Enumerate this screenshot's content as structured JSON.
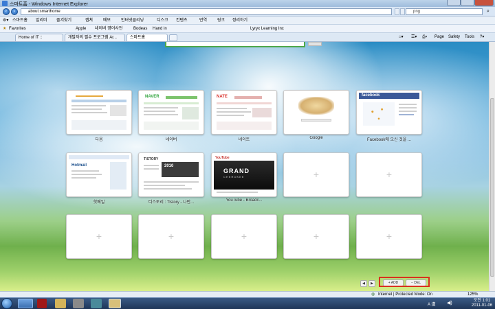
{
  "window": {
    "title": "스마트홈 - Windows Internet Explorer"
  },
  "address": {
    "url": "about:smarthome",
    "search_value": "png"
  },
  "toolbar": {
    "items": [
      "스마트홈",
      "알리미",
      "즐겨찾기",
      "캡쳐",
      "메모",
      "인터넷클리닝",
      "디스크",
      "컨텐츠",
      "번역",
      "링크",
      "정리하기"
    ]
  },
  "favorites": {
    "label": "Favorites",
    "items": [
      "Apple",
      "네이버 영어사전",
      "Bodeas",
      "Hand in"
    ],
    "extra": "Lyryx Learning Inc"
  },
  "tabs": [
    {
      "label": "Home of IT ::"
    },
    {
      "label": "개발자의 필수 프로그램 Ar..."
    },
    {
      "label": "스마트홈"
    }
  ],
  "commands": {
    "page": "Page",
    "safety": "Safety",
    "tools": "Tools"
  },
  "tiles": [
    {
      "label": "다음",
      "kind": "site"
    },
    {
      "label": "네이버",
      "kind": "site"
    },
    {
      "label": "네이트",
      "kind": "site"
    },
    {
      "label": "Google",
      "kind": "site"
    },
    {
      "label": "Facebook에 오신 것을 ...",
      "kind": "site"
    },
    {
      "label": "핫메일",
      "kind": "site"
    },
    {
      "label": "티스토리 : Tistory - 나만...",
      "kind": "site"
    },
    {
      "label": "YouTube - Broadc...",
      "kind": "site"
    },
    {
      "label": "",
      "kind": "empty"
    },
    {
      "label": "",
      "kind": "empty"
    },
    {
      "label": "",
      "kind": "empty"
    },
    {
      "label": "",
      "kind": "empty"
    },
    {
      "label": "",
      "kind": "empty"
    },
    {
      "label": "",
      "kind": "empty"
    },
    {
      "label": "",
      "kind": "empty"
    }
  ],
  "thumb_text": {
    "naver": "NAVER",
    "nate": "NATE",
    "facebook": "facebook",
    "hotmail": "Hotmail",
    "tistory": "TISTORY",
    "tistory_banner": "2010",
    "youtube": "YouTube",
    "youtube_title": "GRAND",
    "youtube_sub": "CHEROKEE"
  },
  "bottom": {
    "prev": "◀",
    "next": "▶",
    "add": "+ ADD",
    "del": "− DEL"
  },
  "status": {
    "text": "Internet | Protected Mode: On",
    "zoom": "125%"
  },
  "clock": {
    "time": "오전 1:01",
    "date": "2011-01-06"
  },
  "tray": {
    "ime": "A 漢"
  }
}
